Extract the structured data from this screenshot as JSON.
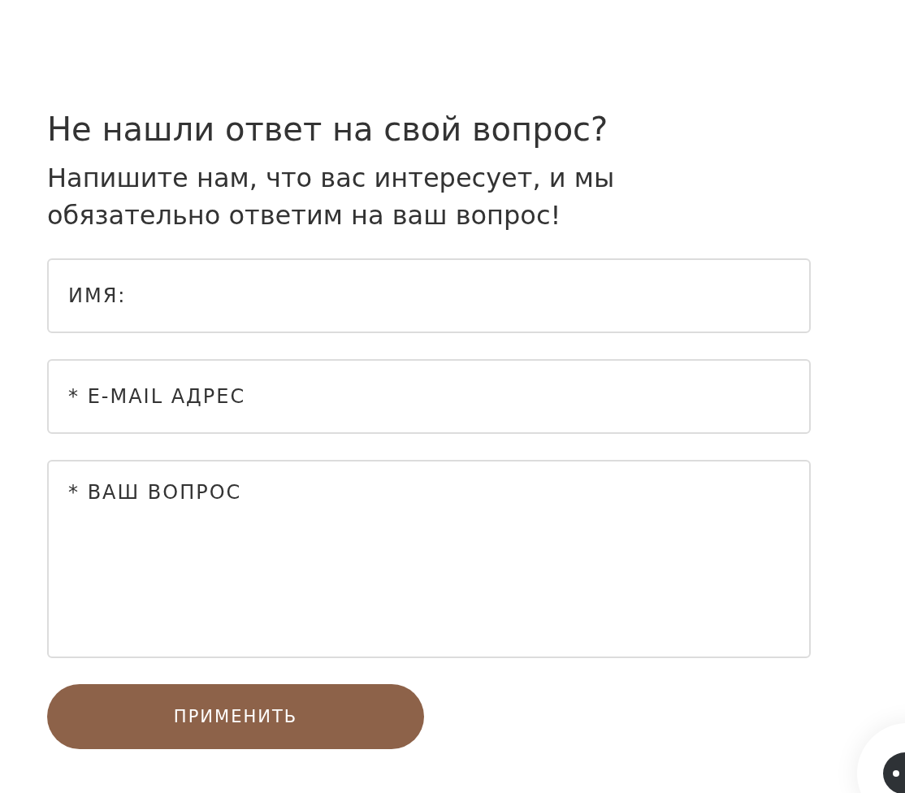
{
  "heading": "Не нашли ответ на свой вопрос?",
  "subtitle": "Напишите нам, что вас интересует, и мы обязательно ответим на ваш вопрос!",
  "fields": [
    {
      "kind": "input",
      "placeholder": "ИМЯ:"
    },
    {
      "kind": "input",
      "placeholder": "* E-MAIL АДРЕС"
    },
    {
      "kind": "textarea",
      "placeholder": "* ВАШ ВОПРОС"
    }
  ],
  "submit_button": "ПРИМЕНИТЬ"
}
